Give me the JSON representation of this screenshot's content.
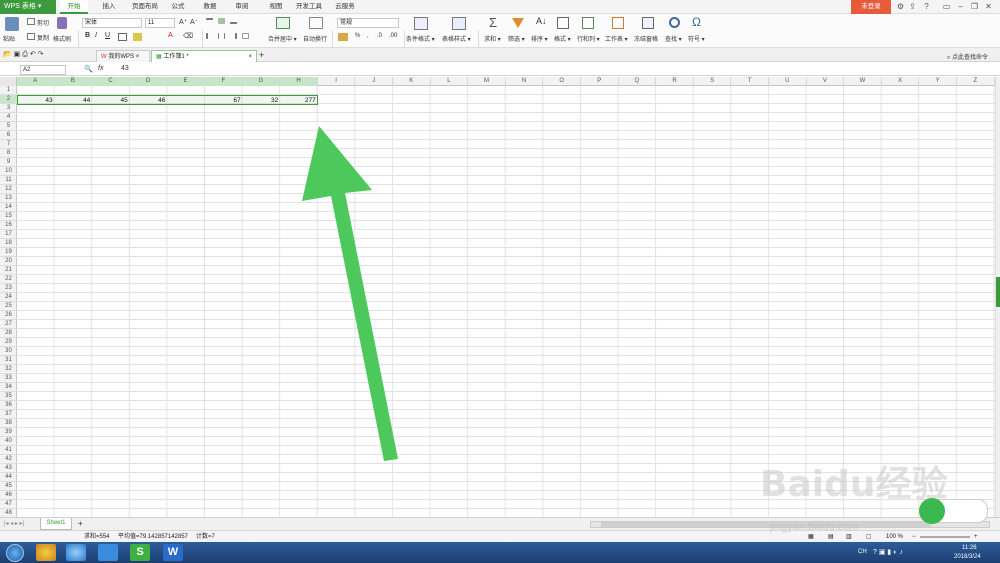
{
  "app": {
    "brand": "WPS 表格",
    "login": "未登录"
  },
  "menu": {
    "tabs": [
      "开始",
      "插入",
      "页面布局",
      "公式",
      "数据",
      "审阅",
      "视图",
      "开发工具",
      "云服务"
    ],
    "active": "开始"
  },
  "ribbon": {
    "paste": "粘贴",
    "cut": "剪切",
    "copy": "复制",
    "format_painter": "格式刷",
    "font_name": "宋体",
    "font_size": "11",
    "bold": "B",
    "italic": "I",
    "underline": "U",
    "merge_center": "合并居中",
    "wrap_text": "自动换行",
    "number_format": "常规",
    "percent": "%",
    "conditional_format": "条件格式",
    "table_style": "表格样式",
    "sum": "求和",
    "filter": "筛选",
    "sort": "排序",
    "format": "格式",
    "row_col": "行和列",
    "worksheet": "工作表",
    "freeze": "冻结窗格",
    "find": "查找",
    "symbol": "符号"
  },
  "doc_tabs": {
    "my_wps": "我的WPS",
    "workbook": "工作簿1 *",
    "search_hint": "点此查找命令"
  },
  "formula_bar": {
    "name_box": "A2",
    "fx": "fx",
    "value": "43"
  },
  "grid": {
    "columns": [
      "A",
      "B",
      "C",
      "D",
      "E",
      "F",
      "G",
      "H",
      "I",
      "J",
      "K",
      "L",
      "M",
      "N",
      "O",
      "P",
      "Q",
      "R",
      "S",
      "T",
      "U",
      "V",
      "W",
      "X",
      "Y",
      "Z"
    ],
    "selected_columns": [
      "A",
      "B",
      "C",
      "D",
      "E",
      "F",
      "G",
      "H"
    ],
    "row_count": 48,
    "selected_row": "2",
    "row2_cells": [
      {
        "col": "A",
        "value": "43"
      },
      {
        "col": "B",
        "value": "44"
      },
      {
        "col": "C",
        "value": "45"
      },
      {
        "col": "D",
        "value": "46"
      },
      {
        "col": "E",
        "value": ""
      },
      {
        "col": "F",
        "value": "67"
      },
      {
        "col": "G",
        "value": "32"
      },
      {
        "col": "H",
        "value": "277"
      }
    ]
  },
  "sheet_tabs": {
    "active": "Sheet1",
    "add": "+"
  },
  "status": {
    "sum": "求和=554",
    "average": "平均值=79.142857142857",
    "count": "计数=7",
    "zoom": "100 %"
  },
  "taskbar": {
    "time": "11:26",
    "date": "2018/3/24",
    "ime": "CH"
  },
  "colors": {
    "accent": "#3c9a3c",
    "arrow": "#4cc85c",
    "login": "#e55b3c",
    "taskbar": "#1d3f72"
  },
  "watermark": {
    "main": "Baidu经验",
    "sub": "jingyan.baidu.com"
  }
}
